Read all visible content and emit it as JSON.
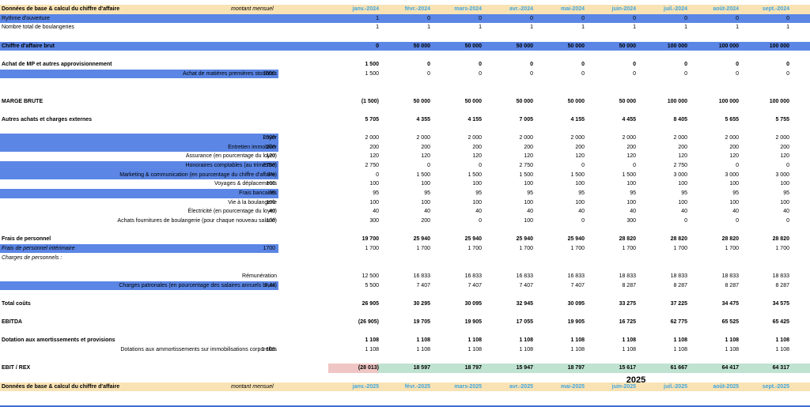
{
  "months_2024": [
    "janv.-2024",
    "févr.-2024",
    "mars-2024",
    "avr.-2024",
    "mai-2024",
    "juin-2024",
    "juil.-2024",
    "août-2024",
    "sept.-2024"
  ],
  "months_2025": [
    "janv.-2025",
    "févr.-2025",
    "mars-2025",
    "avr.-2025",
    "mai-2025",
    "juin-2025",
    "juil.-2025",
    "août-2025",
    "sept.-2025"
  ],
  "header_title": "Données de base & calcul du chiffre d'affaire",
  "header_note": "montant mensuel",
  "year_2025": "2025",
  "rows": [
    {
      "type": "hdr",
      "label": "Données de base & calcul du chiffre d'affaire",
      "note": "montant mensuel",
      "months": "2024"
    },
    {
      "type": "blue",
      "label": "Rythme d'ouverture",
      "values": [
        "1",
        "0",
        "0",
        "0",
        "0",
        "0",
        "0",
        "0",
        "0"
      ]
    },
    {
      "label": "Nombre total de boulangeries",
      "values": [
        "1",
        "1",
        "1",
        "1",
        "1",
        "1",
        "1",
        "1",
        "1"
      ]
    },
    {
      "type": "spacer"
    },
    {
      "type": "blue",
      "bold": true,
      "label": "Chiffre d'affaire brut",
      "values": [
        "0",
        "50 000",
        "50 000",
        "50 000",
        "50 000",
        "50 000",
        "100 000",
        "100 000",
        "100 000"
      ]
    },
    {
      "type": "spacer"
    },
    {
      "bold": true,
      "label": "Achat de MP et autres approvisionnement",
      "values": [
        "1 500",
        "0",
        "0",
        "0",
        "0",
        "0",
        "0",
        "0",
        "0"
      ]
    },
    {
      "type": "partblue",
      "align": "right",
      "label": "Achat de matières premières stockées",
      "input": "1500",
      "values": [
        "1 500",
        "0",
        "0",
        "0",
        "0",
        "0",
        "0",
        "0",
        "0"
      ]
    },
    {
      "type": "spacer"
    },
    {
      "type": "spacer"
    },
    {
      "bold": true,
      "label": "MARGE BRUTE",
      "values": [
        "(1 500)",
        "50 000",
        "50 000",
        "50 000",
        "50 000",
        "50 000",
        "100 000",
        "100 000",
        "100 000"
      ]
    },
    {
      "type": "spacer"
    },
    {
      "bold": true,
      "label": "Autres achats et charges externes",
      "values": [
        "5 705",
        "4 355",
        "4 155",
        "7 005",
        "4 155",
        "4 455",
        "8 405",
        "5 655",
        "5 755"
      ]
    },
    {
      "type": "spacer"
    },
    {
      "type": "partblue",
      "align": "right",
      "label": "Loyer",
      "input": "2000",
      "values": [
        "2 000",
        "2 000",
        "2 000",
        "2 000",
        "2 000",
        "2 000",
        "2 000",
        "2 000",
        "2 000"
      ]
    },
    {
      "type": "partblue",
      "align": "right",
      "label": "Entretien immobilier",
      "input": "200",
      "values": [
        "200",
        "200",
        "200",
        "200",
        "200",
        "200",
        "200",
        "200",
        "200"
      ]
    },
    {
      "align": "right",
      "label": "Assurance (en pourcentage du loyer)",
      "input": "120",
      "values": [
        "120",
        "120",
        "120",
        "120",
        "120",
        "120",
        "120",
        "120",
        "120"
      ]
    },
    {
      "type": "partblue",
      "align": "right",
      "label": "Honoraires comptables (au trimestre)",
      "input": "2750",
      "values": [
        "2 750",
        "0",
        "0",
        "2 750",
        "0",
        "0",
        "2 750",
        "0",
        "0"
      ]
    },
    {
      "type": "partblue",
      "align": "right",
      "label": "Marketing & communication (en pourcentage du chiffre d'affaire)",
      "input": "3%",
      "values": [
        "0",
        "1 500",
        "1 500",
        "1 500",
        "1 500",
        "1 500",
        "3 000",
        "3 000",
        "3 000"
      ]
    },
    {
      "align": "right",
      "label": "Voyages & déplacements",
      "input": "100",
      "values": [
        "100",
        "100",
        "100",
        "100",
        "100",
        "100",
        "100",
        "100",
        "100"
      ]
    },
    {
      "type": "partblue",
      "align": "right",
      "label": "Frais bancaires",
      "input": "95",
      "values": [
        "95",
        "95",
        "95",
        "95",
        "95",
        "95",
        "95",
        "95",
        "95"
      ]
    },
    {
      "align": "right",
      "label": "Vie à la boulangerie",
      "input": "100",
      "values": [
        "100",
        "100",
        "100",
        "100",
        "100",
        "100",
        "100",
        "100",
        "100"
      ]
    },
    {
      "align": "right",
      "label": "Électricité (en pourcentage du loyer)",
      "input": "40",
      "values": [
        "40",
        "40",
        "40",
        "40",
        "40",
        "40",
        "40",
        "40",
        "40"
      ]
    },
    {
      "align": "right",
      "label": "Achats fournitures de boulangerie (pour chaque nouveau salarié)",
      "input": "100",
      "values": [
        "300",
        "200",
        "0",
        "100",
        "0",
        "300",
        "0",
        "0",
        "0"
      ]
    },
    {
      "type": "spacer"
    },
    {
      "bold": true,
      "label": "Frais de personnel",
      "values": [
        "19 700",
        "25 940",
        "25 940",
        "25 940",
        "25 940",
        "28 820",
        "28 820",
        "28 820",
        "28 820"
      ]
    },
    {
      "type": "partblue",
      "ital": true,
      "label": "Frais de personnel intérimaire",
      "input": "1700",
      "values": [
        "1 700",
        "1 700",
        "1 700",
        "1 700",
        "1 700",
        "1 700",
        "1 700",
        "1 700",
        "1 700"
      ]
    },
    {
      "ital": true,
      "label": "Charges de personnels :"
    },
    {
      "type": "spacer"
    },
    {
      "align": "right",
      "label": "Rémunération",
      "values": [
        "12 500",
        "16 833",
        "16 833",
        "16 833",
        "16 833",
        "18 833",
        "18 833",
        "18 833",
        "18 833"
      ]
    },
    {
      "type": "partblue",
      "align": "right",
      "label": "Charges patronales (en pourcentage des salaires annuels bruts)",
      "input": "0,44",
      "values": [
        "5 500",
        "7 407",
        "7 407",
        "7 407",
        "7 407",
        "8 287",
        "8 287",
        "8 287",
        "8 287"
      ]
    },
    {
      "type": "spacer"
    },
    {
      "bold": true,
      "label": "Total coûts",
      "values": [
        "26 905",
        "30 295",
        "30 095",
        "32 945",
        "30 095",
        "33 275",
        "37 225",
        "34 475",
        "34 575"
      ]
    },
    {
      "type": "spacer"
    },
    {
      "bold": true,
      "label": "EBITDA",
      "values": [
        "(26 905)",
        "19 705",
        "19 905",
        "17 055",
        "19 905",
        "16 725",
        "62 775",
        "65 525",
        "65 425"
      ]
    },
    {
      "type": "spacer"
    },
    {
      "bold": true,
      "label": "Dotation aux amortissements et provisions",
      "values": [
        "1 108",
        "1 108",
        "1 108",
        "1 108",
        "1 108",
        "1 108",
        "1 108",
        "1 108",
        "1 108"
      ]
    },
    {
      "align": "right",
      "label": "Dotations aux ammortissements sur immobilisations corporelles",
      "input": "1 108",
      "values": [
        "1 108",
        "1 108",
        "1 108",
        "1 108",
        "1 108",
        "1 108",
        "1 108",
        "1 108",
        "1 108"
      ]
    },
    {
      "type": "spacer"
    },
    {
      "type": "ebit",
      "bold": true,
      "label": "EBIT / REX",
      "values": [
        "(28 013)",
        "18 597",
        "18 797",
        "15 947",
        "18 797",
        "15 617",
        "61 667",
        "64 417",
        "64 317"
      ]
    },
    {
      "type": "spacer"
    },
    {
      "type": "hdr",
      "label": "Données de base & calcul du chiffre d'affaire",
      "note": "montant mensuel",
      "months": "2025"
    }
  ]
}
